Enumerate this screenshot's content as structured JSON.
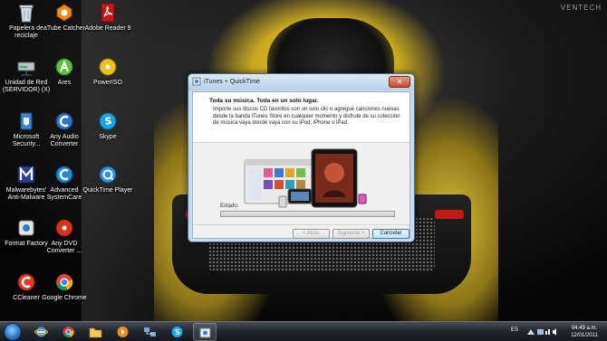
{
  "wallpaper": {
    "watermark": "VENTECH"
  },
  "desktop_icons": [
    {
      "name": "recycle-bin-icon",
      "label": "Papelera de reciclaje"
    },
    {
      "name": "atube-catcher-icon",
      "label": "aTube Catcher"
    },
    {
      "name": "adobe-reader-icon",
      "label": "Adobe Reader 9"
    },
    {
      "name": "network-drive-icon",
      "label": "Unidad de Red (SERVIDOR) (X)"
    },
    {
      "name": "ares-icon",
      "label": "Ares"
    },
    {
      "name": "poweriso-icon",
      "label": "PowerISO"
    },
    {
      "name": "security-essentials-icon",
      "label": "Microsoft Security..."
    },
    {
      "name": "any-audio-converter-icon",
      "label": "Any Audio Converter"
    },
    {
      "name": "skype-icon",
      "label": "Skype"
    },
    {
      "name": "malwarebytes-icon",
      "label": "Malwarebytes' Anti-Malware"
    },
    {
      "name": "advanced-systemcare-icon",
      "label": "Advanced SystemCare"
    },
    {
      "name": "quicktime-icon",
      "label": "QuickTime Player"
    },
    {
      "name": "format-factory-icon",
      "label": "Format Factory"
    },
    {
      "name": "any-dvd-converter-icon",
      "label": "Any DVD Converter ..."
    },
    {
      "name": "ccleaner-icon",
      "label": "CCleaner"
    },
    {
      "name": "google-chrome-icon",
      "label": "Google Chrome"
    }
  ],
  "dialog": {
    "title": "iTunes + QuickTime",
    "close_label": "✕",
    "header_title": "Toda su música. Toda en un solo lugar.",
    "header_body": "Importe sus discos CD favoritos con un solo clic o agregue canciones nuevas desde la banda iTunes Store en cualquier momento y disfrute de su colección de música vaya donde vaya con su iPod, iPhone o iPad.",
    "status_label": "Estado:",
    "progress": 0,
    "buttons": {
      "back": "< Atrás",
      "next": "Siguiente >",
      "cancel": "Cancelar"
    }
  },
  "taskbar": {
    "pinned": [
      {
        "name": "internet-explorer-icon",
        "active": false
      },
      {
        "name": "chrome-taskbar-icon",
        "active": false
      },
      {
        "name": "explorer-folder-icon",
        "active": false
      },
      {
        "name": "media-player-icon",
        "active": false
      },
      {
        "name": "network-map-icon",
        "active": false
      },
      {
        "name": "skype-taskbar-icon",
        "active": false
      },
      {
        "name": "itunes-installer-icon",
        "active": true
      }
    ],
    "language": "ES",
    "time": "04:49 a.m.",
    "date": "12/01/2011"
  }
}
